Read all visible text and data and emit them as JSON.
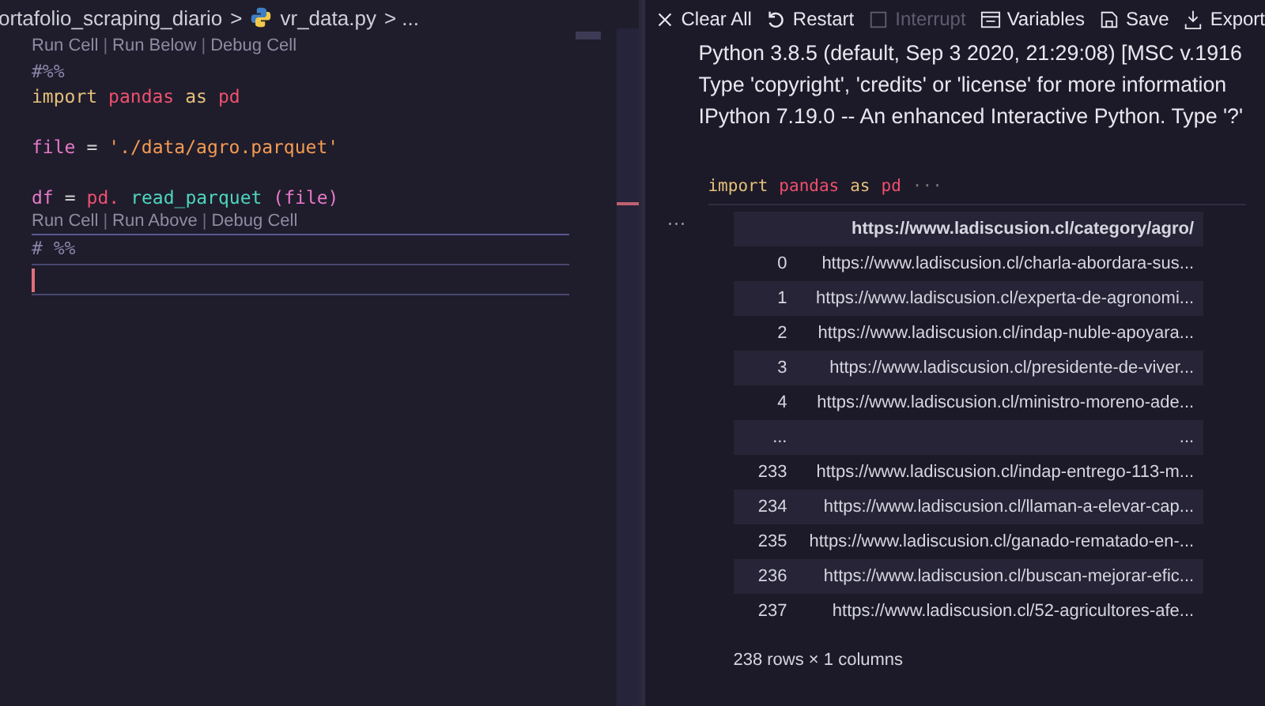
{
  "breadcrumb": {
    "folder": "ortafolio_scraping_diario",
    "separator": ">",
    "file": "vr_data.py",
    "tail": "> ..."
  },
  "editor_lines": [
    {
      "kind": "lens",
      "parts": [
        {
          "text": "Run Cell",
          "kind": "link"
        },
        {
          "text": "|",
          "kind": "sep"
        },
        {
          "text": "Run Below",
          "kind": "link"
        },
        {
          "text": "|",
          "kind": "sep"
        },
        {
          "text": "Debug Cell",
          "kind": "link"
        }
      ]
    },
    {
      "kind": "code",
      "tokens": [
        {
          "text": "#%%",
          "kind": "comment"
        }
      ]
    },
    {
      "kind": "code",
      "tokens": [
        {
          "text": "import",
          "kind": "keyword"
        },
        {
          "text": "pandas",
          "kind": "name"
        },
        {
          "text": "as",
          "kind": "keyword"
        },
        {
          "text": "pd",
          "kind": "name"
        }
      ]
    },
    {
      "kind": "blank"
    },
    {
      "kind": "code",
      "tokens": [
        {
          "text": "file",
          "kind": "var"
        },
        {
          "text": "=",
          "kind": "op"
        },
        {
          "text": "'./data/agro.parquet'",
          "kind": "string"
        }
      ]
    },
    {
      "kind": "blank"
    },
    {
      "kind": "code",
      "tokens": [
        {
          "text": "df",
          "kind": "var"
        },
        {
          "text": "=",
          "kind": "op"
        },
        {
          "text": "pd.",
          "kind": "name"
        },
        {
          "text": "read_parquet",
          "kind": "func"
        },
        {
          "text": "(file)",
          "kind": "var"
        }
      ]
    },
    {
      "kind": "lens",
      "parts": [
        {
          "text": "Run Cell",
          "kind": "link"
        },
        {
          "text": "|",
          "kind": "sep"
        },
        {
          "text": "Run Above",
          "kind": "link"
        },
        {
          "text": "|",
          "kind": "sep"
        },
        {
          "text": "Debug Cell",
          "kind": "link"
        }
      ]
    },
    {
      "kind": "cell",
      "tokens": [
        {
          "text": "# %%",
          "kind": "comment"
        }
      ]
    },
    {
      "kind": "cursor"
    }
  ],
  "toolbar": [
    {
      "label": "Clear All",
      "kind": "clear",
      "disabled": false
    },
    {
      "label": "Restart",
      "kind": "restart",
      "disabled": false
    },
    {
      "label": "Interrupt",
      "kind": "interrupt",
      "disabled": true
    },
    {
      "label": "Variables",
      "kind": "variables",
      "disabled": false
    },
    {
      "label": "Save",
      "kind": "save",
      "disabled": false
    },
    {
      "label": "Export",
      "kind": "export",
      "disabled": false
    }
  ],
  "banner": [
    "Python 3.8.5 (default, Sep 3 2020, 21:29:08) [MSC v.1916",
    "Type 'copyright', 'credits' or 'license' for more information",
    "IPython 7.19.0 -- An enhanced Interactive Python. Type '?'"
  ],
  "input_cell": {
    "tokens": [
      {
        "text": "import",
        "kind": "keyword"
      },
      {
        "text": "pandas",
        "kind": "name"
      },
      {
        "text": "as",
        "kind": "keyword"
      },
      {
        "text": "pd",
        "kind": "name"
      }
    ],
    "more": "···"
  },
  "output_more": "···",
  "table": {
    "columns": [
      "https://www.ladiscusion.cl/category/agro/"
    ],
    "rows": [
      {
        "index": "0",
        "value": "https://www.ladiscusion.cl/charla-abordara-sus..."
      },
      {
        "index": "1",
        "value": "https://www.ladiscusion.cl/experta-de-agronomi..."
      },
      {
        "index": "2",
        "value": "https://www.ladiscusion.cl/indap-nuble-apoyara..."
      },
      {
        "index": "3",
        "value": "https://www.ladiscusion.cl/presidente-de-viver..."
      },
      {
        "index": "4",
        "value": "https://www.ladiscusion.cl/ministro-moreno-ade..."
      },
      {
        "index": "...",
        "value": "..."
      },
      {
        "index": "233",
        "value": "https://www.ladiscusion.cl/indap-entrego-113-m..."
      },
      {
        "index": "234",
        "value": "https://www.ladiscusion.cl/llaman-a-elevar-cap..."
      },
      {
        "index": "235",
        "value": "https://www.ladiscusion.cl/ganado-rematado-en-..."
      },
      {
        "index": "236",
        "value": "https://www.ladiscusion.cl/buscan-mejorar-efic..."
      },
      {
        "index": "237",
        "value": "https://www.ladiscusion.cl/52-agricultores-afe..."
      }
    ],
    "summary": "238 rows × 1 columns"
  }
}
